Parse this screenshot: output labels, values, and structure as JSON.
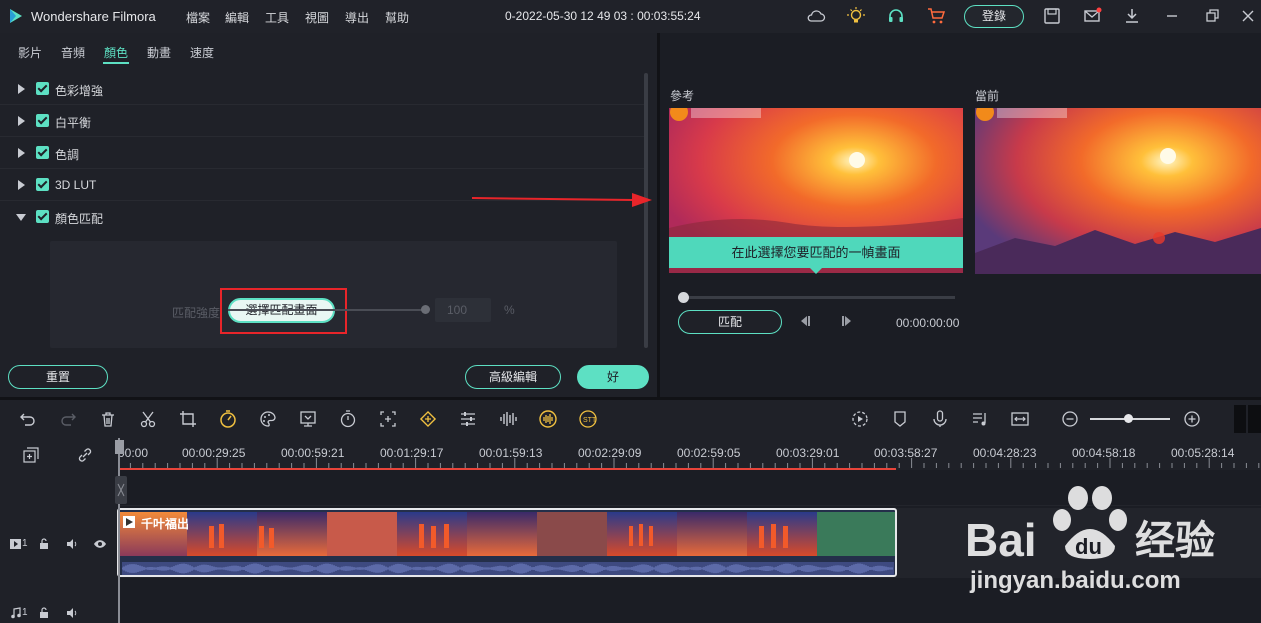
{
  "titlebar": {
    "app_name": "Wondershare Filmora",
    "menu": [
      "檔案",
      "編輯",
      "工具",
      "視圖",
      "導出",
      "幫助"
    ],
    "project_title": "0-2022-05-30 12 49 03 : 00:03:55:24",
    "login_label": "登錄"
  },
  "left_panel": {
    "tabs": [
      "影片",
      "音頻",
      "顏色",
      "動畫",
      "速度"
    ],
    "active_tab": "顏色",
    "sections": [
      "色彩增強",
      "白平衡",
      "色調",
      "3D LUT",
      "顏色匹配"
    ],
    "select_frame_label": "選擇匹配畫面",
    "strength_label": "匹配強度",
    "strength_value": "100",
    "strength_unit": "%",
    "reset_label": "重置",
    "advanced_label": "高級編輯",
    "ok_label": "好"
  },
  "right_panel": {
    "reference_label": "參考",
    "current_label": "當前",
    "hint": "在此選擇您要匹配的一幀畫面",
    "match_label": "匹配",
    "match_time": "00:00:00:00"
  },
  "timeline": {
    "ruler_labels": [
      "00:00",
      "00:00:29:25",
      "00:00:59:21",
      "00:01:29:17",
      "00:01:59:13",
      "00:02:29:09",
      "00:02:59:05",
      "00:03:29:01",
      "00:03:58:27",
      "00:04:28:23",
      "00:04:58:18",
      "00:05:28:14"
    ],
    "clip_title": "千叶福出",
    "video_track_num": "1",
    "audio_track_num": "1"
  },
  "watermark": {
    "brand": "Bai",
    "brand_suffix": "du",
    "cn_text": "经验",
    "url": "jingyan.baidu.com"
  },
  "colors": {
    "accent": "#5de0c3",
    "highlight_red": "#e8252a"
  }
}
